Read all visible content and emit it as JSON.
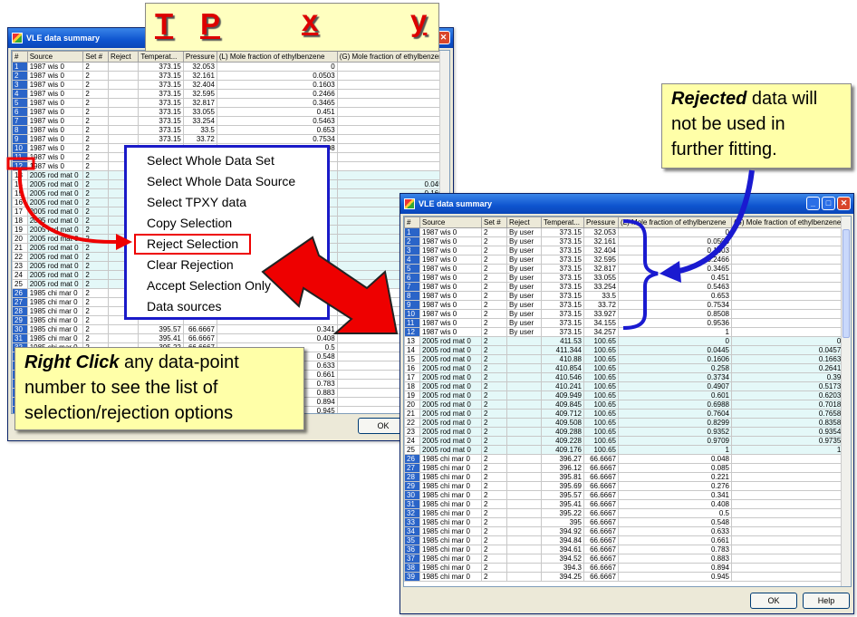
{
  "window1": {
    "title": "VLE data summary",
    "headers": [
      "#",
      "Source",
      "Set #",
      "Reject",
      "Temperat...",
      "Pressure",
      "(L) Mole fraction of ethylbenzene",
      "(G) Mole fraction of ethylbenzene"
    ],
    "ok": "OK"
  },
  "window2": {
    "title": "VLE data summary",
    "headers": [
      "#",
      "Source",
      "Set #",
      "Reject",
      "Temperat...",
      "Pressure",
      "(L) Mole fraction of ethylbenzene",
      "(G) Mole fraction of ethylbenzene"
    ],
    "ok": "OK",
    "help": "Help"
  },
  "header_letters": [
    "T",
    "P",
    "x",
    "y"
  ],
  "context_menu": [
    "Select Whole Data Set",
    "Select Whole Data Source",
    "Select TPXY data",
    "Copy Selection",
    "Reject Selection",
    "Clear Rejection",
    "Accept Selection Only",
    "Data sources"
  ],
  "callout_rejected": {
    "em": "Rejected",
    "rest1": " data will",
    "line2": "not be used in",
    "line3": "further fitting."
  },
  "callout_right_click": {
    "em": "Right Click",
    "rest1": " any data-point",
    "line2": "number to see the list of",
    "line3": "selection/rejection options"
  },
  "rows1": [
    [
      "1",
      "1987 wis",
      "0",
      "2",
      "",
      "373.15",
      "32.053",
      "0",
      ""
    ],
    [
      "2",
      "1987 wis",
      "0",
      "2",
      "",
      "373.15",
      "32.161",
      "0.0503",
      ""
    ],
    [
      "3",
      "1987 wis",
      "0",
      "2",
      "",
      "373.15",
      "32.404",
      "0.1603",
      ""
    ],
    [
      "4",
      "1987 wis",
      "0",
      "2",
      "",
      "373.15",
      "32.595",
      "0.2466",
      ""
    ],
    [
      "5",
      "1987 wis",
      "0",
      "2",
      "",
      "373.15",
      "32.817",
      "0.3465",
      ""
    ],
    [
      "6",
      "1987 wis",
      "0",
      "2",
      "",
      "373.15",
      "33.055",
      "0.451",
      ""
    ],
    [
      "7",
      "1987 wis",
      "0",
      "2",
      "",
      "373.15",
      "33.254",
      "0.5463",
      ""
    ],
    [
      "8",
      "1987 wis",
      "0",
      "2",
      "",
      "373.15",
      "33.5",
      "0.653",
      ""
    ],
    [
      "9",
      "1987 wis",
      "0",
      "2",
      "",
      "373.15",
      "33.72",
      "0.7534",
      ""
    ],
    [
      "10",
      "1987 wis",
      "0",
      "2",
      "",
      "373.15",
      "33.927",
      "0.8508",
      ""
    ],
    [
      "11",
      "1987 wis",
      "0",
      "2",
      "",
      "",
      "",
      "",
      ""
    ],
    [
      "12",
      "1987 wis",
      "0",
      "2",
      "",
      "",
      "",
      "",
      ""
    ],
    [
      "13",
      "2005 rod mat",
      "0",
      "2",
      "",
      "",
      "",
      "",
      "0"
    ],
    [
      "14",
      "2005 rod mat",
      "0",
      "2",
      "",
      "",
      "",
      "",
      "0.0457"
    ],
    [
      "15",
      "2005 rod mat",
      "0",
      "2",
      "",
      "",
      "",
      "",
      "0.1663"
    ],
    [
      "16",
      "2005 rod mat",
      "0",
      "2",
      "",
      "",
      "",
      "",
      ""
    ],
    [
      "17",
      "2005 rod mat",
      "0",
      "2",
      "",
      "",
      "",
      "",
      ""
    ],
    [
      "18",
      "2005 rod mat",
      "0",
      "2",
      "",
      "",
      "",
      "",
      ""
    ],
    [
      "19",
      "2005 rod mat",
      "0",
      "2",
      "",
      "",
      "",
      "",
      ""
    ],
    [
      "20",
      "2005 rod mat",
      "0",
      "2",
      "",
      "",
      "",
      "",
      ""
    ],
    [
      "21",
      "2005 rod mat",
      "0",
      "2",
      "",
      "",
      "",
      "",
      ""
    ],
    [
      "22",
      "2005 rod mat",
      "0",
      "2",
      "",
      "",
      "",
      "",
      ""
    ],
    [
      "23",
      "2005 rod mat",
      "0",
      "2",
      "",
      "",
      "",
      "",
      ""
    ],
    [
      "24",
      "2005 rod mat",
      "0",
      "2",
      "",
      "",
      "",
      "",
      ""
    ],
    [
      "25",
      "2005 rod mat",
      "0",
      "2",
      "",
      "",
      "",
      "",
      ""
    ],
    [
      "26",
      "1985 chi mar",
      "0",
      "2",
      "",
      "",
      "",
      "",
      ""
    ],
    [
      "27",
      "1985 chi mar",
      "0",
      "2",
      "",
      "",
      "",
      "",
      ""
    ],
    [
      "28",
      "1985 chi mar",
      "0",
      "2",
      "",
      "",
      "",
      "",
      ""
    ],
    [
      "29",
      "1985 chi mar",
      "0",
      "2",
      "",
      "",
      "",
      "",
      ""
    ],
    [
      "30",
      "1985 chi mar",
      "0",
      "2",
      "",
      "395.57",
      "66.6667",
      "0.341",
      ""
    ],
    [
      "31",
      "1985 chi mar",
      "0",
      "2",
      "",
      "395.41",
      "66.6667",
      "0.408",
      ""
    ],
    [
      "32",
      "1985 chi mar",
      "0",
      "2",
      "",
      "395.22",
      "66.6667",
      "0.5",
      ""
    ],
    [
      "33",
      "",
      "",
      "",
      "",
      "",
      "",
      "0.548",
      ""
    ],
    [
      "34",
      "",
      "",
      "",
      "",
      "",
      "",
      "0.633",
      ""
    ],
    [
      "35",
      "",
      "",
      "",
      "",
      "",
      "",
      "0.661",
      ""
    ],
    [
      "36",
      "",
      "",
      "",
      "",
      "",
      "",
      "0.783",
      ""
    ],
    [
      "37",
      "",
      "",
      "",
      "",
      "",
      "",
      "0.883",
      ""
    ],
    [
      "38",
      "",
      "",
      "",
      "",
      "",
      "",
      "0.894",
      ""
    ],
    [
      "39",
      "",
      "",
      "",
      "",
      "",
      "",
      "0.945",
      ""
    ]
  ],
  "rows2": [
    [
      "1",
      "1987 wis",
      "0",
      "2",
      "By user",
      "373.15",
      "32.053",
      "0",
      ""
    ],
    [
      "2",
      "1987 wis",
      "0",
      "2",
      "By user",
      "373.15",
      "32.161",
      "0.0503",
      ""
    ],
    [
      "3",
      "1987 wis",
      "0",
      "2",
      "By user",
      "373.15",
      "32.404",
      "0.1603",
      ""
    ],
    [
      "4",
      "1987 wis",
      "0",
      "2",
      "By user",
      "373.15",
      "32.595",
      "0.2466",
      ""
    ],
    [
      "5",
      "1987 wis",
      "0",
      "2",
      "By user",
      "373.15",
      "32.817",
      "0.3465",
      ""
    ],
    [
      "6",
      "1987 wis",
      "0",
      "2",
      "By user",
      "373.15",
      "33.055",
      "0.451",
      ""
    ],
    [
      "7",
      "1987 wis",
      "0",
      "2",
      "By user",
      "373.15",
      "33.254",
      "0.5463",
      ""
    ],
    [
      "8",
      "1987 wis",
      "0",
      "2",
      "By user",
      "373.15",
      "33.5",
      "0.653",
      ""
    ],
    [
      "9",
      "1987 wis",
      "0",
      "2",
      "By user",
      "373.15",
      "33.72",
      "0.7534",
      ""
    ],
    [
      "10",
      "1987 wis",
      "0",
      "2",
      "By user",
      "373.15",
      "33.927",
      "0.8508",
      ""
    ],
    [
      "11",
      "1987 wis",
      "0",
      "2",
      "By user",
      "373.15",
      "34.155",
      "0.9536",
      ""
    ],
    [
      "12",
      "1987 wis",
      "0",
      "2",
      "By user",
      "373.15",
      "34.257",
      "1",
      ""
    ],
    [
      "13",
      "2005 rod mat",
      "0",
      "2",
      "",
      "411.53",
      "100.65",
      "0",
      "0"
    ],
    [
      "14",
      "2005 rod mat",
      "0",
      "2",
      "",
      "411.344",
      "100.65",
      "0.0445",
      "0.0457"
    ],
    [
      "15",
      "2005 rod mat",
      "0",
      "2",
      "",
      "410.88",
      "100.65",
      "0.1606",
      "0.1663"
    ],
    [
      "16",
      "2005 rod mat",
      "0",
      "2",
      "",
      "410.854",
      "100.65",
      "0.258",
      "0.2641"
    ],
    [
      "17",
      "2005 rod mat",
      "0",
      "2",
      "",
      "410.546",
      "100.65",
      "0.3734",
      "0.39"
    ],
    [
      "18",
      "2005 rod mat",
      "0",
      "2",
      "",
      "410.241",
      "100.65",
      "0.4907",
      "0.5173"
    ],
    [
      "19",
      "2005 rod mat",
      "0",
      "2",
      "",
      "409.949",
      "100.65",
      "0.601",
      "0.6203"
    ],
    [
      "20",
      "2005 rod mat",
      "0",
      "2",
      "",
      "409.845",
      "100.65",
      "0.6988",
      "0.7018"
    ],
    [
      "21",
      "2005 rod mat",
      "0",
      "2",
      "",
      "409.712",
      "100.65",
      "0.7604",
      "0.7658"
    ],
    [
      "22",
      "2005 rod mat",
      "0",
      "2",
      "",
      "409.508",
      "100.65",
      "0.8299",
      "0.8358"
    ],
    [
      "23",
      "2005 rod mat",
      "0",
      "2",
      "",
      "409.288",
      "100.65",
      "0.9352",
      "0.9354"
    ],
    [
      "24",
      "2005 rod mat",
      "0",
      "2",
      "",
      "409.228",
      "100.65",
      "0.9709",
      "0.9735"
    ],
    [
      "25",
      "2005 rod mat",
      "0",
      "2",
      "",
      "409.176",
      "100.65",
      "1",
      "1"
    ],
    [
      "26",
      "1985 chi mar",
      "0",
      "2",
      "",
      "396.27",
      "66.6667",
      "0.048",
      ""
    ],
    [
      "27",
      "1985 chi mar",
      "0",
      "2",
      "",
      "396.12",
      "66.6667",
      "0.085",
      ""
    ],
    [
      "28",
      "1985 chi mar",
      "0",
      "2",
      "",
      "395.81",
      "66.6667",
      "0.221",
      ""
    ],
    [
      "29",
      "1985 chi mar",
      "0",
      "2",
      "",
      "395.69",
      "66.6667",
      "0.276",
      ""
    ],
    [
      "30",
      "1985 chi mar",
      "0",
      "2",
      "",
      "395.57",
      "66.6667",
      "0.341",
      ""
    ],
    [
      "31",
      "1985 chi mar",
      "0",
      "2",
      "",
      "395.41",
      "66.6667",
      "0.408",
      ""
    ],
    [
      "32",
      "1985 chi mar",
      "0",
      "2",
      "",
      "395.22",
      "66.6667",
      "0.5",
      ""
    ],
    [
      "33",
      "1985 chi mar",
      "0",
      "2",
      "",
      "395",
      "66.6667",
      "0.548",
      ""
    ],
    [
      "34",
      "1985 chi mar",
      "0",
      "2",
      "",
      "394.92",
      "66.6667",
      "0.633",
      ""
    ],
    [
      "35",
      "1985 chi mar",
      "0",
      "2",
      "",
      "394.84",
      "66.6667",
      "0.661",
      ""
    ],
    [
      "36",
      "1985 chi mar",
      "0",
      "2",
      "",
      "394.61",
      "66.6667",
      "0.783",
      ""
    ],
    [
      "37",
      "1985 chi mar",
      "0",
      "2",
      "",
      "394.52",
      "66.6667",
      "0.883",
      ""
    ],
    [
      "38",
      "1985 chi mar",
      "0",
      "2",
      "",
      "394.3",
      "66.6667",
      "0.894",
      ""
    ],
    [
      "39",
      "1985 chi mar",
      "0",
      "2",
      "",
      "394.25",
      "66.6667",
      "0.945",
      ""
    ]
  ]
}
